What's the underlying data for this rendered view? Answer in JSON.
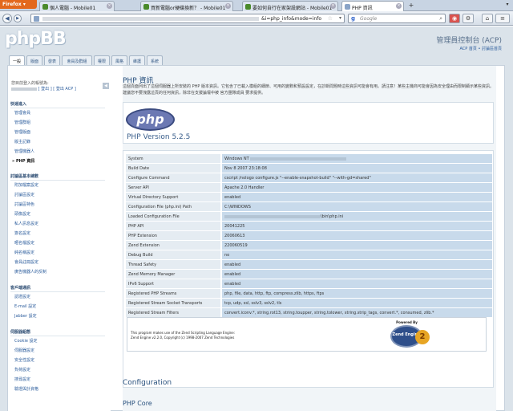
{
  "browser": {
    "menu_label": "Firefox ▾",
    "tabs": [
      {
        "label": "個人電腦 - Mobile01",
        "active": false
      },
      {
        "label": "買新電腦or硬碟換新？ - Mobile01",
        "active": false
      },
      {
        "label": "要如何自行在家架設網站 - Mobile01",
        "active": false
      },
      {
        "label": "PHP 資訊",
        "active": true
      }
    ],
    "new_tab": "+",
    "url_suffix": "&i=php_info&mode=info",
    "search_placeholder": "Google",
    "search_engine_glyph": "g"
  },
  "header": {
    "logo": "phpBB",
    "acp_title": "管理員控制台 (ACP)",
    "acp_links": "ACP 首頁 • 討論區首頁"
  },
  "acp_tabs": [
    "一般",
    "版面",
    "發表",
    "會員及群組",
    "權限",
    "風格",
    "維護",
    "系統"
  ],
  "sidebar": {
    "logged_in_as": "您目前登入的帳號為:",
    "logout": "[ 登出 ]",
    "logout_acp": "[ 登出 ACP ]",
    "collapse": "◀",
    "sections": [
      {
        "title": "快速進入",
        "items": [
          "管理會員",
          "管理群組",
          "管理版面",
          "版主記錄",
          "管理機器人",
          "PHP 資訊"
        ]
      },
      {
        "title": "討論區基本總數",
        "items": [
          "附加檔案設定",
          "討論區設定",
          "討論區特色",
          "頭像設定",
          "私人訊息設定",
          "簽名設定",
          "暱名檔設定",
          "純名稱設定",
          "會員註冊設定",
          "廣告機器人的反制"
        ]
      },
      {
        "title": "客戶端通訊",
        "items": [
          "認證設定",
          "E-mail 設定",
          "Jabber 設定"
        ]
      },
      {
        "title": "伺服器組態",
        "items": [
          "Cookie 設定",
          "伺服器設定",
          "安全性設定",
          "負荷設定",
          "搜尋設定",
          "驗證與計資格"
        ]
      }
    ]
  },
  "main": {
    "title": "PHP 資訊",
    "description": "這個頁面列出了這個伺服器上所安裝的 PHP 版本資訊。它包含了已載入模組的細節、可用的變數和預設設定，在診斷問題時這些資訊可能會有用。請注意！某些主機商可能會因為安全理由而限制顯示某些資訊。建議您不要洩露這頁的任何資訊，除非在支援論壇中被 官方團隊成員 要求提供。",
    "php_logo": "php",
    "php_version": "PHP Version 5.2.5",
    "info_rows": [
      {
        "key": "System",
        "value": "Windows NT"
      },
      {
        "key": "Build Date",
        "value": "Nov 8 2007 23:18:08"
      },
      {
        "key": "Configure Command",
        "value": "cscript /nologo configure.js \"--enable-snapshot-build\" \"--with-gd=shared\""
      },
      {
        "key": "Server API",
        "value": "Apache 2.0 Handler"
      },
      {
        "key": "Virtual Directory Support",
        "value": "enabled"
      },
      {
        "key": "Configuration File (php.ini) Path",
        "value": "C:\\WINDOWS"
      },
      {
        "key": "Loaded Configuration File",
        "value": "\\bin\\php.ini"
      },
      {
        "key": "PHP API",
        "value": "20041225"
      },
      {
        "key": "PHP Extension",
        "value": "20060613"
      },
      {
        "key": "Zend Extension",
        "value": "220060519"
      },
      {
        "key": "Debug Build",
        "value": "no"
      },
      {
        "key": "Thread Safety",
        "value": "enabled"
      },
      {
        "key": "Zend Memory Manager",
        "value": "enabled"
      },
      {
        "key": "IPv6 Support",
        "value": "enabled"
      },
      {
        "key": "Registered PHP Streams",
        "value": "php, file, data, http, ftp, compress.zlib, https, ftps"
      },
      {
        "key": "Registered Stream Socket Transports",
        "value": "tcp, udp, ssl, sslv3, sslv2, tls"
      },
      {
        "key": "Registered Stream Filters",
        "value": "convert.iconv.*, string.rot13, string.toupper, string.tolower, string.strip_tags, convert.*, consumed, zlib.*"
      }
    ],
    "zend_text_1": "This program makes use of the Zend Scripting Language Engine:",
    "zend_text_2": "Zend Engine v2.2.0, Copyright (c) 1998-2007 Zend Technologies",
    "zend_powered": "Powered By",
    "zend_logo_text": "Zend Engine",
    "zend_logo_num": "2",
    "configuration_title": "Configuration",
    "php_core_title": "PHP Core"
  }
}
